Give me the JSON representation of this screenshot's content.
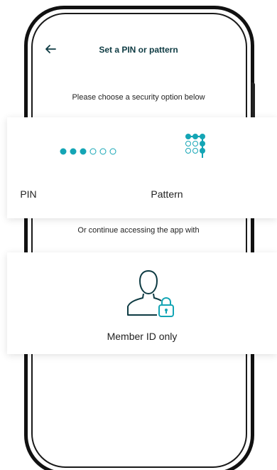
{
  "header": {
    "title": "Set a PIN or pattern",
    "back_icon": "arrow-left-icon"
  },
  "instruction": "Please choose a security option below",
  "options": [
    {
      "label": "PIN",
      "icon": "pin-dots-icon"
    },
    {
      "label": "Pattern",
      "icon": "pattern-grid-icon"
    }
  ],
  "or_continue": "Or continue accessing the app with",
  "member_option": {
    "label": "Member ID only",
    "icon": "user-lock-icon"
  },
  "colors": {
    "accent": "#14a5b5",
    "title": "#0e3b43",
    "text": "#222222"
  }
}
